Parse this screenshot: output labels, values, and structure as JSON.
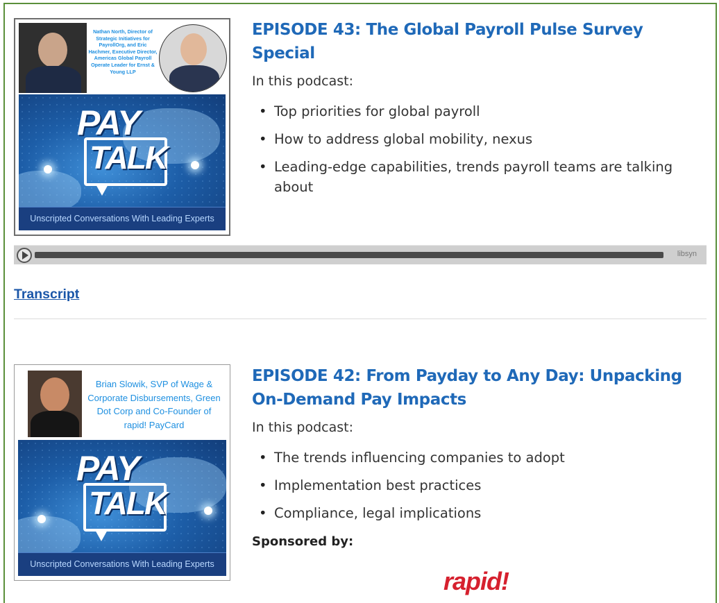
{
  "episodes": [
    {
      "title": "EPISODE 43: The Global Payroll Pulse Survey Special",
      "intro": "In this podcast:",
      "guest_caption": "Nathan North, Director of Strategic Initiatives for PayrollOrg, and Eric Hachmer, Executive Director, Americas Global Payroll Operate Leader for Ernst & Young LLP",
      "banner_logo_word1": "PAY",
      "banner_logo_word2": "TALK",
      "banner_tagline": "Unscripted Conversations With Leading Experts",
      "bullets": [
        "Top priorities for global payroll",
        "How to address global mobility, nexus",
        "Leading-edge capabilities, trends payroll teams are talking about"
      ]
    },
    {
      "title": "EPISODE 42: From Payday to Any Day: Unpacking On-Demand Pay Impacts",
      "intro": "In this podcast:",
      "guest_caption": "Brian Slowik, SVP of Wage & Corporate Disbursements, Green Dot Corp and Co-Founder of rapid! PayCard",
      "banner_logo_word1": "PAY",
      "banner_logo_word2": "TALK",
      "banner_tagline": "Unscripted Conversations With Leading Experts",
      "bullets": [
        "The trends influencing companies to adopt",
        "Implementation best practices",
        "Compliance, legal implications"
      ],
      "sponsored_label": "Sponsored by:",
      "sponsor_name": "rapid!"
    }
  ],
  "player": {
    "play_icon": "play-icon",
    "brand": "libsyn"
  },
  "transcript_link": "Transcript",
  "colors": {
    "title_blue": "#1f69b8",
    "link_blue": "#1a56a8",
    "frame_green": "#5a8f3a",
    "sponsor_red": "#d6202e"
  }
}
